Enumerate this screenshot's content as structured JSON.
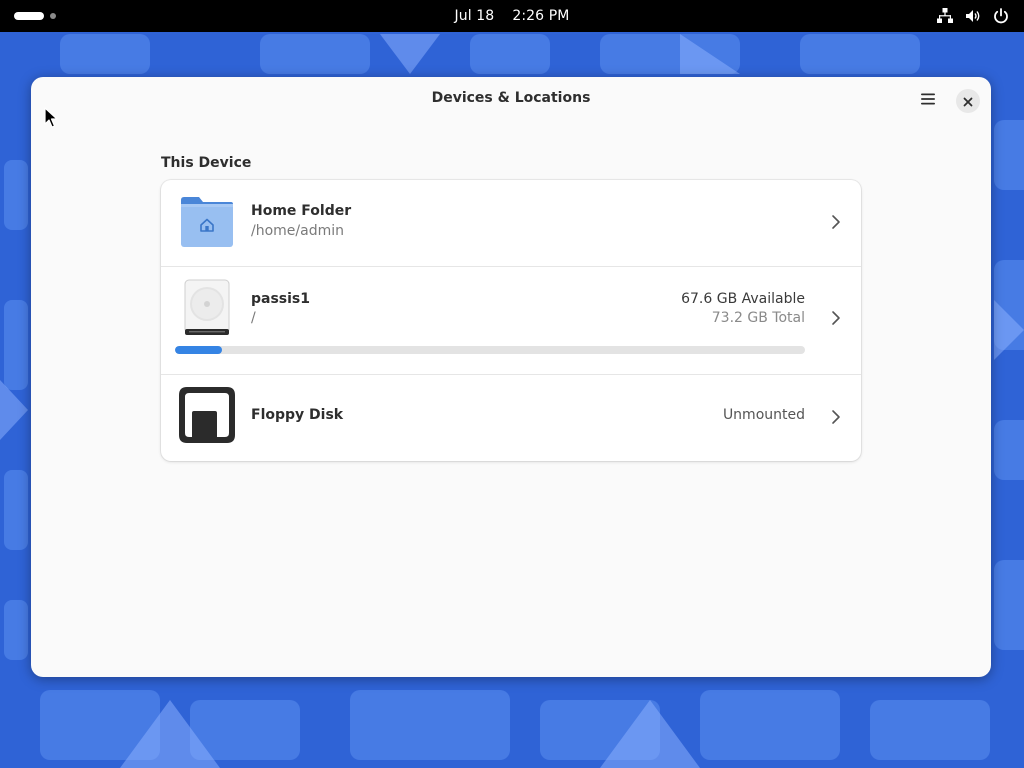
{
  "topbar": {
    "date": "Jul 18",
    "time": "2:26 PM",
    "icons": [
      "network-wired-icon",
      "volume-icon",
      "power-icon"
    ]
  },
  "window": {
    "title": "Devices & Locations",
    "menu_icon": "hamburger-menu-icon",
    "close_icon": "close-icon"
  },
  "section": {
    "label": "This Device"
  },
  "devices": [
    {
      "name": "Home Folder",
      "path": "/home/admin",
      "icon": "home-folder-icon"
    },
    {
      "name": "passis1",
      "path": "/",
      "available": "67.6 GB Available",
      "total": "73.2 GB Total",
      "usage_fraction": 0.075,
      "icon": "hard-disk-icon"
    },
    {
      "name": "Floppy Disk",
      "status": "Unmounted",
      "icon": "floppy-disk-icon"
    }
  ],
  "colors": {
    "accent": "#3584e4",
    "topbar": "#000000",
    "window_bg": "#fafafa",
    "wallpaper": "#2f63d6"
  }
}
